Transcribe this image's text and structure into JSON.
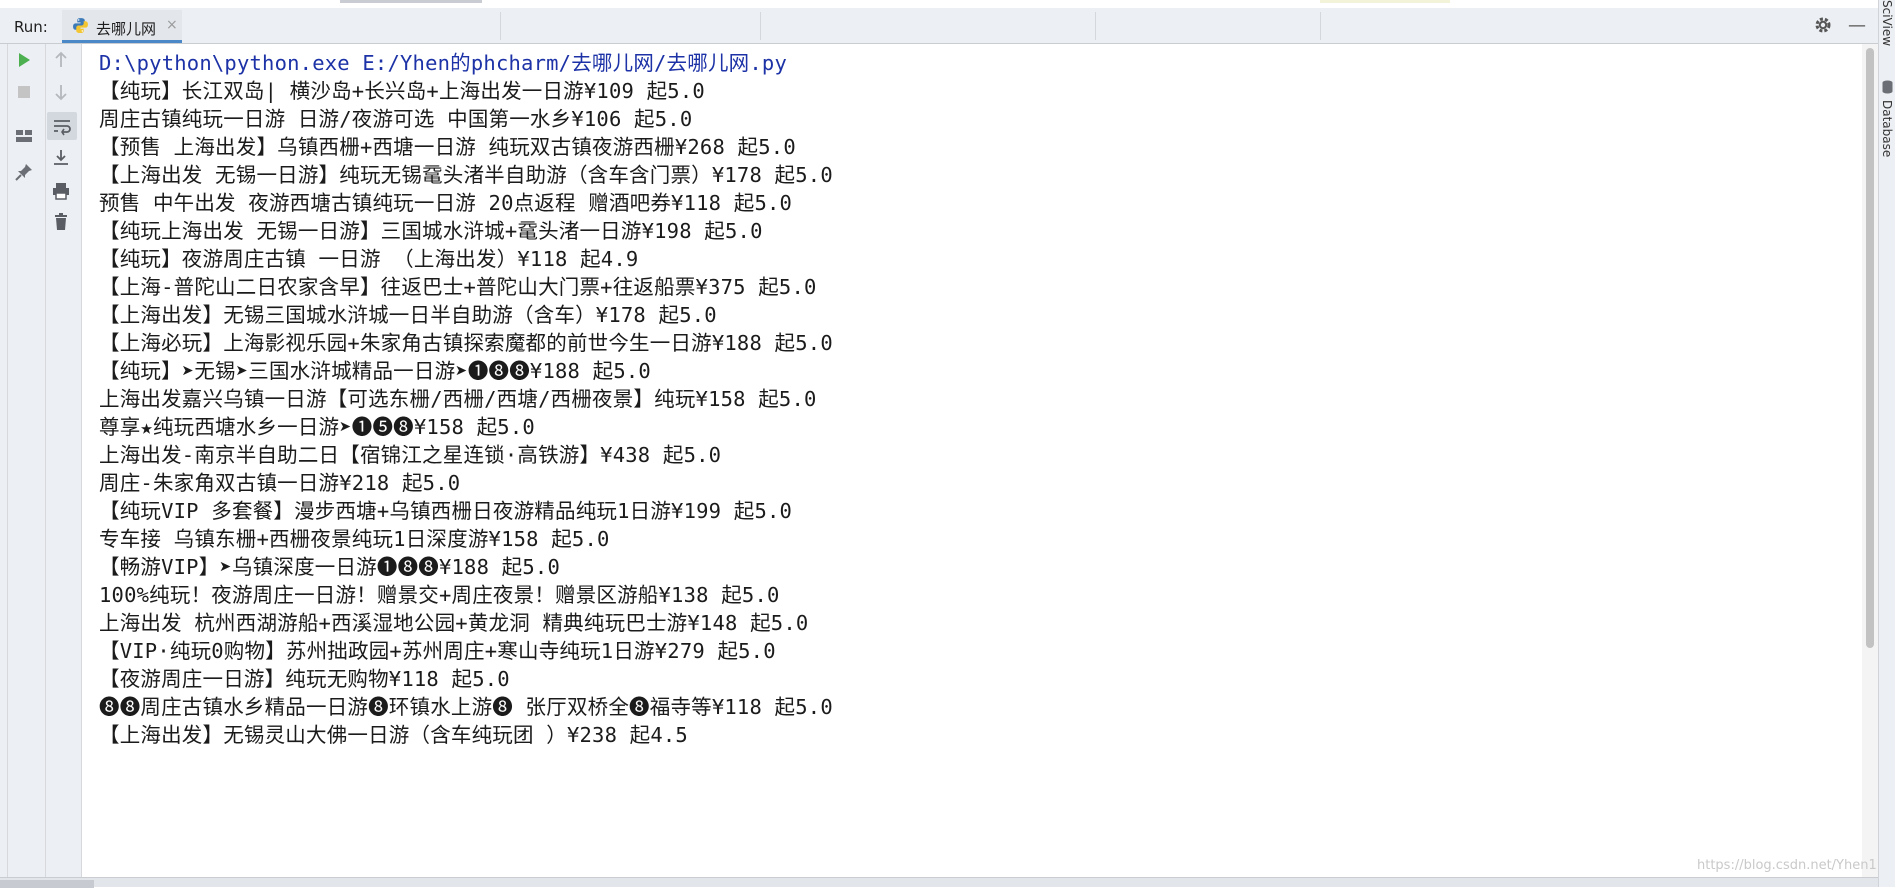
{
  "run_panel": {
    "label": "Run:",
    "tab_title": "去哪儿网",
    "tab_close": "×"
  },
  "gutter_icons": [
    "run-icon",
    "stop-icon",
    "scroll-up-icon",
    "scroll-down-icon",
    "layout-icon",
    "soft-wrap-icon",
    "pin-icon",
    "scroll-to-end-icon",
    "print-icon",
    "trash-icon"
  ],
  "right_sidebar": {
    "sciview": "SciView",
    "database": "Database"
  },
  "console": {
    "command": "D:\\python\\python.exe E:/Yhen的phcharm/去哪儿网/去哪儿网.py",
    "lines": [
      "【纯玩】长江双岛| 横沙岛+长兴岛+上海出发一日游¥109 起5.0",
      "周庄古镇纯玩一日游 日游/夜游可选 中国第一水乡¥106 起5.0",
      "【预售 上海出发】乌镇西栅+西塘一日游 纯玩双古镇夜游西栅¥268 起5.0",
      "【上海出发 无锡一日游】纯玩无锡鼋头渚半自助游（含车含门票）¥178 起5.0",
      "预售 中午出发 夜游西塘古镇纯玩一日游 20点返程 赠酒吧券¥118 起5.0",
      "【纯玩上海出发 无锡一日游】三国城水浒城+鼋头渚一日游¥198 起5.0",
      "【纯玩】夜游周庄古镇 一日游 （上海出发）¥118 起4.9",
      "【上海-普陀山二日农家含早】往返巴士+普陀山大门票+往返船票¥375 起5.0",
      "【上海出发】无锡三国城水浒城一日半自助游（含车）¥178 起5.0",
      "【上海必玩】上海影视乐园+朱家角古镇探索魔都的前世今生一日游¥188 起5.0",
      "【纯玩】➤无锡➤三国水浒城精品一日游➤❶❽❽¥188 起5.0",
      "上海出发嘉兴乌镇一日游【可选东栅/西栅/西塘/西栅夜景】纯玩¥158 起5.0",
      "尊享★纯玩西塘水乡一日游➤❶❺❽¥158 起5.0",
      "上海出发-南京半自助二日【宿锦江之星连锁·高铁游】¥438 起5.0",
      "周庄-朱家角双古镇一日游¥218 起5.0",
      "【纯玩VIP 多套餐】漫步西塘+乌镇西栅日夜游精品纯玩1日游¥199 起5.0",
      "专车接 乌镇东栅+西栅夜景纯玩1日深度游¥158 起5.0",
      "【畅游VIP】➤乌镇深度一日游❶❽❽¥188 起5.0",
      "100%纯玩！夜游周庄一日游！赠景交+周庄夜景！赠景区游船¥138 起5.0",
      "上海出发 杭州西湖游船+西溪湿地公园+黄龙洞 精典纯玩巴士游¥148 起5.0",
      "【VIP·纯玩0购物】苏州拙政园+苏州周庄+寒山寺纯玩1日游¥279 起5.0",
      "【夜游周庄一日游】纯玩无购物¥118 起5.0",
      "❽❽周庄古镇水乡精品一日游❽环镇水上游❽ 张厅双桥全❽福寺等¥118 起5.0",
      "【上海出发】无锡灵山大佛一日游（含车纯玩团 ）¥238 起4.5"
    ]
  },
  "watermark": "https://blog.csdn.net/Yhen1"
}
